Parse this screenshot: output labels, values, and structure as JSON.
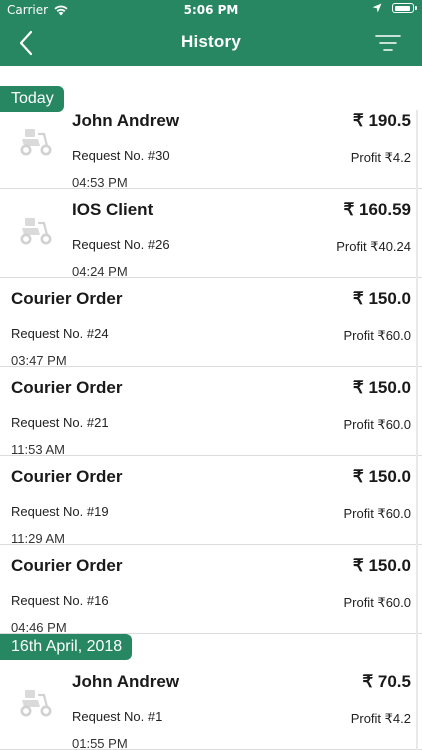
{
  "status_bar": {
    "carrier": "Carrier",
    "time": "5:06 PM"
  },
  "nav": {
    "title": "History",
    "back_icon": "chevron-left-icon",
    "filter_icon": "filter-icon"
  },
  "colors": {
    "primary": "#278763",
    "divider": "#dcdcdc",
    "text": "#1a1a1a"
  },
  "sections": [
    {
      "label": "Today",
      "rows": [
        {
          "name": "John Andrew",
          "request": "Request No. #30",
          "time": "04:53 PM",
          "amount": "₹ 190.5",
          "profit": "Profit ₹4.2",
          "icon": "scooter-icon"
        },
        {
          "name": "IOS Client",
          "request": "Request No. #26",
          "time": "04:24 PM",
          "amount": "₹ 160.59",
          "profit": "Profit ₹40.24",
          "icon": "scooter-icon"
        },
        {
          "name": "Courier Order",
          "request": "Request No. #24",
          "time": "03:47 PM",
          "amount": "₹ 150.0",
          "profit": "Profit ₹60.0"
        },
        {
          "name": "Courier Order",
          "request": "Request No. #21",
          "time": "11:53 AM",
          "amount": "₹ 150.0",
          "profit": "Profit ₹60.0"
        },
        {
          "name": "Courier Order",
          "request": "Request No. #19",
          "time": "11:29 AM",
          "amount": "₹ 150.0",
          "profit": "Profit ₹60.0"
        },
        {
          "name": "Courier Order",
          "request": "Request No. #16",
          "time": "04:46 PM",
          "amount": "₹ 150.0",
          "profit": "Profit ₹60.0"
        }
      ]
    },
    {
      "label": "16th April, 2018",
      "rows": [
        {
          "name": "John Andrew",
          "request": "Request No. #1",
          "time": "01:55 PM",
          "amount": "₹ 70.5",
          "profit": "Profit ₹4.2",
          "icon": "scooter-icon"
        }
      ]
    }
  ]
}
